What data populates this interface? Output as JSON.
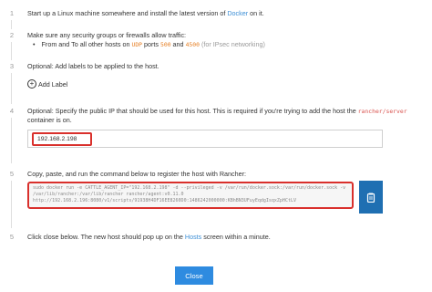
{
  "steps": [
    {
      "num": "1",
      "pre": "Start up a Linux machine somewhere and install the latest version of ",
      "link": "Docker",
      "post": " on it."
    },
    {
      "num": "2",
      "text": "Make sure any security groups or firewalls allow traffic:",
      "bullet": {
        "pre": "From and To all other hosts on ",
        "proto": "UDP",
        "mid": " ports ",
        "port1": "500",
        "and": " and ",
        "port2": "4500",
        "note": " (for IPsec networking)"
      }
    },
    {
      "num": "3",
      "text": "Optional: Add labels to be applied to the host.",
      "add_label": "Add Label"
    },
    {
      "num": "4",
      "pre": "Optional: Specify the public IP that should be used for this host. This is required if you're trying to add the host the ",
      "code": "rancher/server",
      "post": " container is on.",
      "ip_value": "192.168.2.198"
    },
    {
      "num": "5",
      "text": "Copy, paste, and run the command below to register the host with Rancher:",
      "command": "sudo docker run -e CATTLE_AGENT_IP=\"192.168.2.198\"  -d --privileged -v /var/run/docker.sock:/var/run/docker.sock -v /var/lib/rancher:/var/lib/rancher rancher/agent:v0.11.0 http://192.168.2.196:8080/v1/scripts/91938H4DF16EE8260D0:1486242000000:KBhBN3UFuyEqdgIsqxZpHCtLV"
    },
    {
      "num": "5",
      "pre": "Click close below. The new host should pop up on the ",
      "link": "Hosts",
      "post": " screen within a minute."
    }
  ],
  "close_label": "Close",
  "icons": {
    "add": "plus-circle-icon",
    "copy": "clipboard-icon"
  },
  "colors": {
    "link": "#3d8fd6",
    "highlight_border": "#d9302c",
    "primary_button": "#2e8be0",
    "copy_button": "#1f6fb2"
  }
}
